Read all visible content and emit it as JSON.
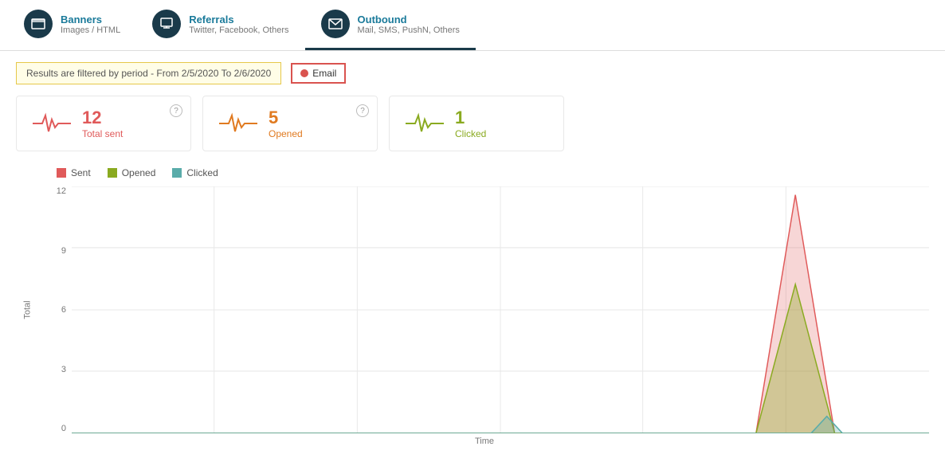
{
  "tabs": [
    {
      "id": "banners",
      "title": "Banners",
      "sub": "Images / HTML",
      "icon": "🖼",
      "active": false
    },
    {
      "id": "referrals",
      "title": "Referrals",
      "sub": "Twitter, Facebook, Others",
      "icon": "👥",
      "active": false
    },
    {
      "id": "outbound",
      "title": "Outbound",
      "sub": "Mail, SMS, PushN, Others",
      "icon": "✉",
      "active": true
    }
  ],
  "filter": {
    "text": "Results are filtered by period - From 2/5/2020 To 2/6/2020",
    "badge": "Email"
  },
  "stats": [
    {
      "id": "total-sent",
      "number": "12",
      "label": "Total sent",
      "color": "red"
    },
    {
      "id": "opened",
      "number": "5",
      "label": "Opened",
      "color": "orange"
    },
    {
      "id": "clicked",
      "number": "1",
      "label": "Clicked",
      "color": "green"
    }
  ],
  "chart": {
    "legend": [
      {
        "label": "Sent",
        "color": "#e05a5a"
      },
      {
        "label": "Opened",
        "color": "#8aaa20"
      },
      {
        "label": "Clicked",
        "color": "#5aacaa"
      }
    ],
    "y_axis": "Total",
    "x_axis": "Time",
    "y_ticks": [
      "0",
      "3",
      "6",
      "9",
      "12"
    ],
    "grid_lines": 5
  },
  "icons": {
    "banner": "🖼",
    "referral": "🔗",
    "outbound": "✉",
    "help": "?",
    "email_dot": "●"
  }
}
